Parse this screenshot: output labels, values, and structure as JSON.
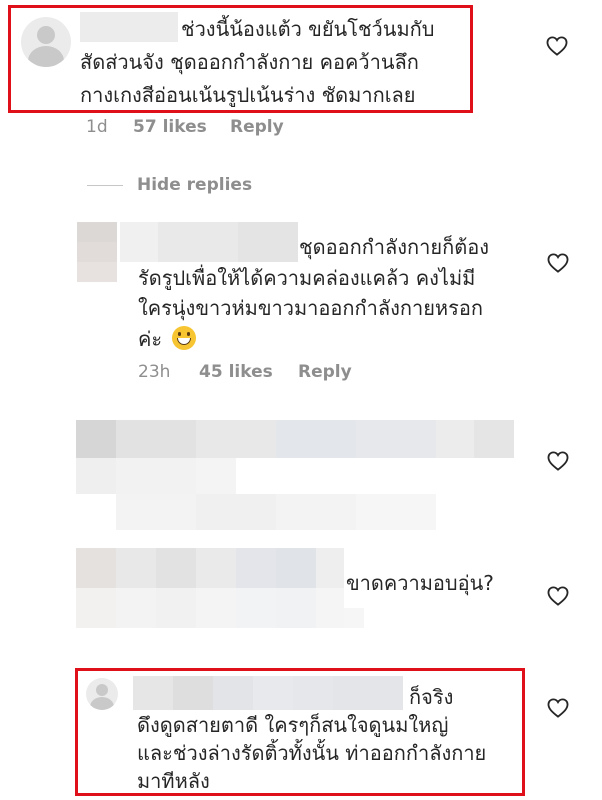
{
  "comments": [
    {
      "text_lines": [
        "ช่วงนี้น้องแต้ว ขยันโชว์นมกับ",
        "สัดส่วนจัง ชุดออกกำลังกาย คอคว้านลึก",
        "กางเกงสีอ่อนเน้นรูปเน้นร่าง ชัดมากเลย"
      ],
      "time": "1d",
      "likes": "57 likes",
      "reply_label": "Reply",
      "highlighted": true
    },
    {
      "text_lines": [
        "ชุดออกกำลังกายก็ต้อง",
        "รัดรูปเพื่อให้ได้ความคล่องแคล้ว คงไม่มี",
        "ใครนุ่งขาวห่มขาวมาออกกำลังกายหรอก",
        "ค่ะ"
      ],
      "emoji": "grinning-face-emoji",
      "time": "23h",
      "likes": "45 likes",
      "reply_label": "Reply"
    },
    {
      "text_lines": []
    },
    {
      "text_lines": [
        "ขาดความอบอุ่น?"
      ]
    },
    {
      "text_lines": [
        "ก็จริง",
        "ดึงดูดสายตาดี ใครๆก็สนใจดูนมใหญ่",
        "และช่วงล่างรัดติ้วทั้งนั้น ท่าออกกำลังกาย",
        "มาทีหลัง"
      ],
      "highlighted": true
    }
  ],
  "hide_replies_label": "Hide replies",
  "colors": {
    "highlight_border": "#e0101a",
    "meta_text": "#8e8e8e",
    "body_text": "#262626"
  }
}
